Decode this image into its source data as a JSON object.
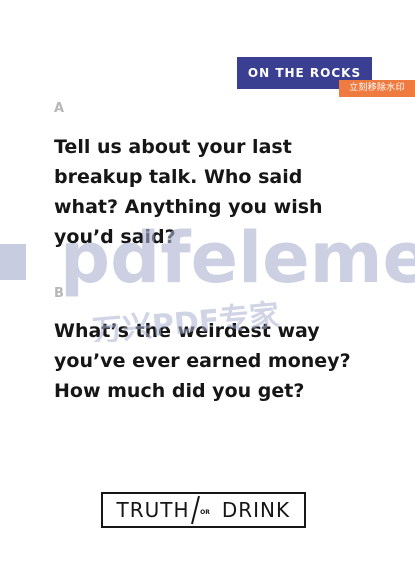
{
  "card": {
    "tag": "ON THE ROCKS",
    "remove_watermark": "立刻移除水印",
    "options": [
      {
        "letter": "A",
        "lines": [
          "Tell us about your last",
          "breakup talk. Who said",
          "what? Anything you wish",
          "you’d said?"
        ]
      },
      {
        "letter": "B",
        "lines": [
          "What’s the weirdest way",
          "you’ve ever earned money?",
          "How much did you get?"
        ]
      }
    ],
    "logo": {
      "left": "TRUTH",
      "middle": "OR",
      "right": "DRINK"
    }
  },
  "watermark": {
    "brand": "pdfeleme",
    "chinese": "万兴PDF专家",
    "color": "#aab0cf"
  }
}
